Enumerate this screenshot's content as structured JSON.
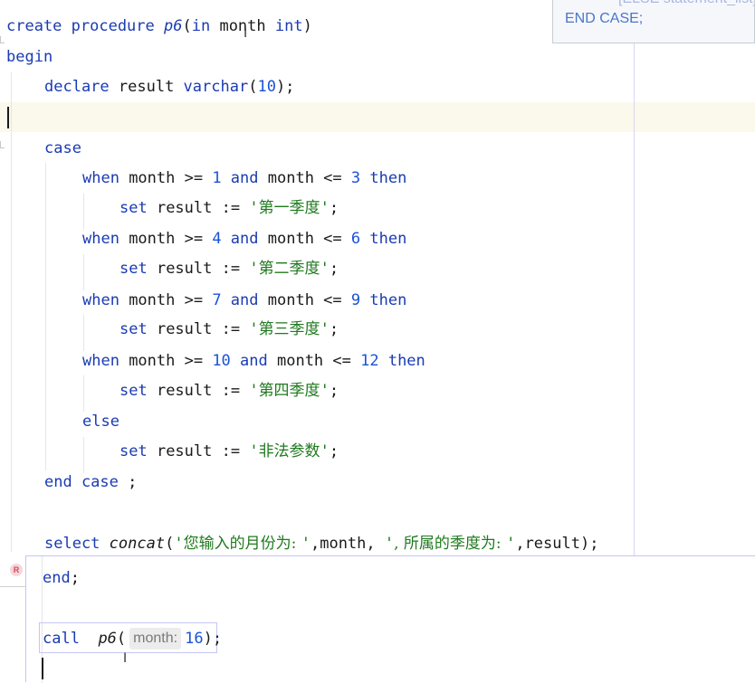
{
  "tooltip": {
    "top_faded": "[ELSE statement_list]",
    "line": "END CASE;"
  },
  "code": {
    "l1": {
      "kw1": "create procedure ",
      "name": "p6",
      "open": "(",
      "kw2": "in",
      "rest": " month ",
      "kw3": "int",
      "close": ")"
    },
    "l2": {
      "kw": "begin"
    },
    "l3": {
      "kw1": "declare",
      "mid": " result ",
      "kw2": "varchar",
      "open": "(",
      "num": "10",
      "close": ");"
    },
    "l5": {
      "kw": "case"
    },
    "when1": {
      "kw1": "when",
      "a": " month >= ",
      "n1": "1",
      "kw2": " and",
      "b": " month <= ",
      "n2": "3",
      "kw3": " then"
    },
    "set1": {
      "kw": "set",
      "a": " result := ",
      "str": "第一季度",
      "end": ";"
    },
    "when2": {
      "kw1": "when",
      "a": " month >= ",
      "n1": "4",
      "kw2": " and",
      "b": " month <= ",
      "n2": "6",
      "kw3": " then"
    },
    "set2": {
      "kw": "set",
      "a": " result := ",
      "str": "第二季度",
      "end": ";"
    },
    "when3": {
      "kw1": "when",
      "a": " month >= ",
      "n1": "7",
      "kw2": " and",
      "b": " month <= ",
      "n2": "9",
      "kw3": " then"
    },
    "set3": {
      "kw": "set",
      "a": " result := ",
      "str": "第三季度",
      "end": ";"
    },
    "when4": {
      "kw1": "when",
      "a": " month >= ",
      "n1": "10",
      "kw2": " and",
      "b": " month <= ",
      "n2": "12",
      "kw3": " then"
    },
    "set4": {
      "kw": "set",
      "a": " result := ",
      "str": "第四季度",
      "end": ";"
    },
    "else": {
      "kw": "else"
    },
    "set5": {
      "kw": "set",
      "a": " result := ",
      "str": "非法参数",
      "end": ";"
    },
    "endcase": {
      "kw": "end case",
      "end": " ;"
    },
    "select": {
      "kw": "select",
      "fn": "concat",
      "open": "(",
      "s1": "您输入的月份为: ",
      "mid": ",month, ",
      "s2": ", 所属的季度为: ",
      "tail": ",result);"
    },
    "end": {
      "kw": "end",
      "end": ";"
    },
    "call": {
      "kw": "call",
      "name": "p6",
      "open": "(",
      "hint": "month:",
      "num": "16",
      "close": ");"
    }
  },
  "run_badge": "R",
  "colors": {
    "keyword": "#1a3bb3",
    "number": "#1a52d6",
    "string": "#1f7a1f",
    "current_line": "#fbf8ec"
  }
}
